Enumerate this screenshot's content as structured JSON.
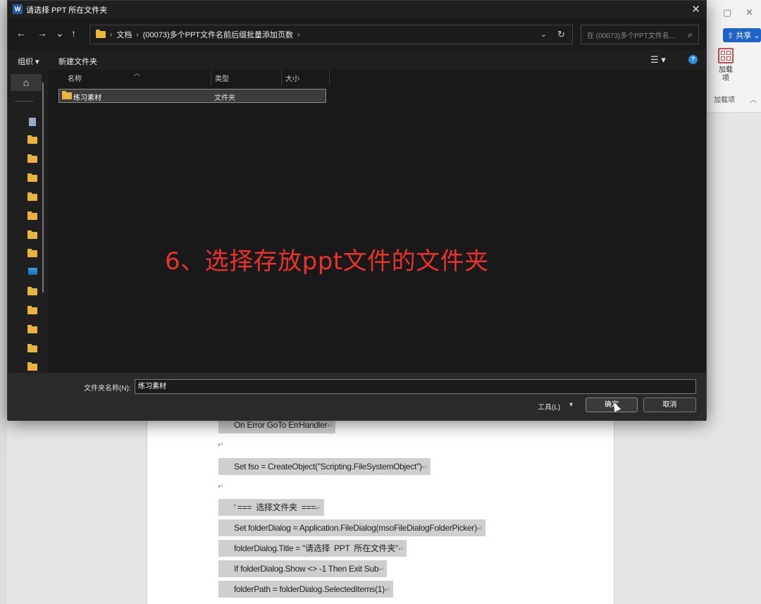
{
  "dialog": {
    "title": "请选择 PPT 所在文件夹",
    "close": "✕",
    "nav": {
      "back": "←",
      "forward": "→",
      "recent": "⌄",
      "up": "↑"
    },
    "breadcrumb": [
      "文档",
      "(00073)多个PPT文件名前后缀批量添加页数"
    ],
    "breadcrumb_sep": "›",
    "search_placeholder": "在 (00073)多个PPT文件名...",
    "toolbar": {
      "organize": "组织 ▾",
      "new_folder": "新建文件夹",
      "view": "☰ ▾",
      "help": "?"
    },
    "columns": {
      "name": "名称",
      "type": "类型",
      "size": "大小"
    },
    "files": [
      {
        "name": "练习素材",
        "type": "文件夹"
      }
    ],
    "annotation": "6、选择存放ppt文件的文件夹",
    "footer": {
      "folder_name_label": "文件夹名称(N):",
      "folder_name_value": "练习素材",
      "tools": "工具(L)",
      "ok": "确定",
      "cancel": "取消"
    }
  },
  "word": {
    "share": "共享",
    "addin_label": "加载项",
    "addin_group": "加载项",
    "code_lines": [
      "On Error GoTo ErrHandler",
      "Set fso = CreateObject(\"Scripting.FileSystemObject\")",
      "' ===  选择文件夹  ===",
      "Set folderDialog = Application.FileDialog(msoFileDialogFolderPicker)",
      "folderDialog.Title = \"请选择  PPT  所在文件夹\"",
      "If folderDialog.Show <> -1 Then Exit Sub",
      "folderPath = folderDialog.SelectedItems(1)"
    ],
    "paragraph_mark": "↵"
  }
}
